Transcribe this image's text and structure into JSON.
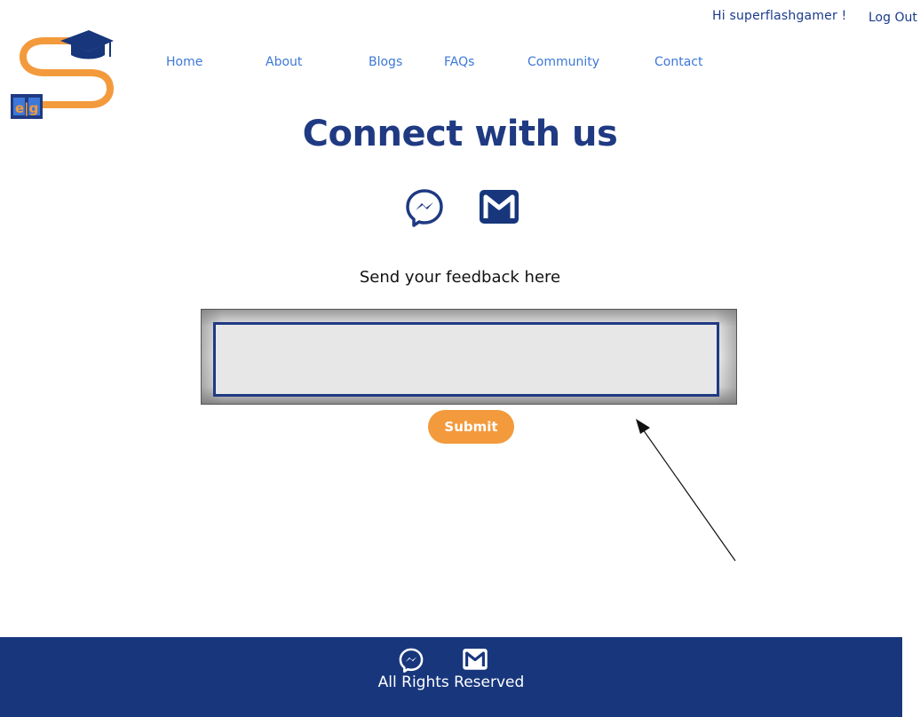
{
  "header": {
    "greeting": "Hi superflashgamer !",
    "logout_label": "Log Out",
    "logo_text": "e|g"
  },
  "nav": {
    "items": [
      {
        "label": "Home"
      },
      {
        "label": "About"
      },
      {
        "label": "Blogs"
      },
      {
        "label": "FAQs"
      },
      {
        "label": "Community"
      },
      {
        "label": "Contact"
      }
    ]
  },
  "main": {
    "title": "Connect with us",
    "social_icons": [
      "messenger-icon",
      "gmail-icon"
    ],
    "feedback_label": "Send your feedback here",
    "feedback_value": "",
    "submit_label": "Submit"
  },
  "footer": {
    "social_icons": [
      "messenger-icon",
      "gmail-icon"
    ],
    "rights": "All Rights Reserved"
  },
  "colors": {
    "primary": "#1f3a82",
    "nav_link": "#3d78d8",
    "accent": "#f39a3d",
    "footer_bg": "#17367c"
  }
}
